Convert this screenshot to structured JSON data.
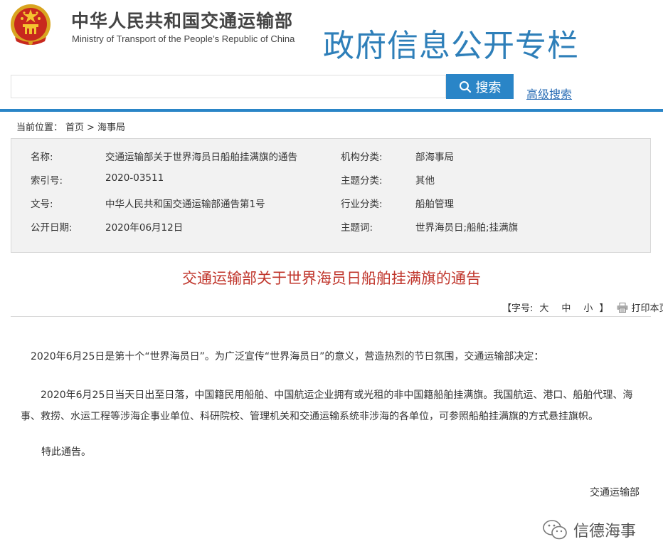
{
  "header": {
    "ministry_cn": "中华人民共和国交通运输部",
    "ministry_en": "Ministry of Transport of the People’s Republic of China",
    "column_title": "政府信息公开专栏",
    "emblem_icon": "national-emblem-icon"
  },
  "search": {
    "value": "",
    "placeholder": "",
    "button_label": "搜索",
    "advanced_label": "高级搜索"
  },
  "breadcrumb": {
    "label": "当前位置：",
    "home": "首页",
    "separator": ">",
    "current": "海事局"
  },
  "info": {
    "rows": [
      {
        "label_l": "名称:",
        "value_l": "交通运输部关于世界海员日船舶挂满旗的通告",
        "label_r": "机构分类:",
        "value_r": "部海事局"
      },
      {
        "label_l": "索引号:",
        "value_l": "2020-03511",
        "label_r": "主题分类:",
        "value_r": "其他"
      },
      {
        "label_l": "文号:",
        "value_l": "中华人民共和国交通运输部通告第1号",
        "label_r": "行业分类:",
        "value_r": "船舶管理"
      },
      {
        "label_l": "公开日期:",
        "value_l": "2020年06月12日",
        "label_r": "主题词:",
        "value_r": "世界海员日;船舶;挂满旗"
      }
    ]
  },
  "article": {
    "title": "交通运输部关于世界海员日船舶挂满旗的通告",
    "font_size_label": "【字号:",
    "size_large": "大",
    "size_medium": "中",
    "size_small": "小",
    "size_close": "】",
    "print_label": "打印本页",
    "para1": "2020年6月25日是第十个“世界海员日”。为广泛宣传“世界海员日”的意义，营造热烈的节日氛围，交通运输部决定：",
    "para2": "2020年6月25日当天日出至日落，中国籍民用船舶、中国航运企业拥有或光租的非中国籍船舶挂满旗。我国航运、港口、船舶代理、海事、救捞、水运工程等涉海企事业单位、科研院校、管理机关和交通运输系统非涉海的各单位，可参照船舶挂满旗的方式悬挂旗帜。",
    "para3": "特此通告。",
    "signature": "交通运输部"
  },
  "watermark": {
    "text": "信德海事",
    "icon": "wechat-icon"
  },
  "colors": {
    "accent_blue": "#2a85c7",
    "title_red": "#c0362c",
    "column_title_blue": "#2e7fb9"
  }
}
